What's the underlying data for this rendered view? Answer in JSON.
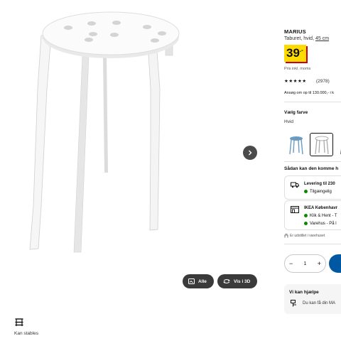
{
  "product": {
    "name": "MARIUS",
    "subtitle_prefix": "Taburet, hvid, ",
    "subtitle_size": "45 cm",
    "price_integer": "39",
    "price_decimal": ".-",
    "vat_note": "Pris inkl. moms",
    "rating_stars": "★★★★★",
    "rating": 4.5,
    "review_count": "(2978)",
    "finance_note": "Ansøg om op til 130.000,- i k"
  },
  "color": {
    "heading": "Vælg farve",
    "selected": "Hvid",
    "swatches": [
      {
        "name": "blue",
        "hex": "#6a9bc3"
      },
      {
        "name": "white",
        "hex": "#ffffff"
      },
      {
        "name": "black",
        "hex": "#222222"
      }
    ]
  },
  "delivery": {
    "heading": "Sådan kan den komme h",
    "shipping_title": "Levering til 230",
    "shipping_status": "Tilgængelig",
    "store_title": "IKEA Københavr",
    "store_pickup": "Klik & Hent - T",
    "store_warehouse": "Varehus - På l",
    "exhibit_note": "Er udstillet i varehuset"
  },
  "cart": {
    "quantity": "1",
    "minus": "−",
    "plus": "+"
  },
  "help": {
    "title": "Vi kan hjælpe",
    "text": "Du kan få din MA"
  },
  "gallery": {
    "all_label": "Alle",
    "view3d_label": "Vis i 3D",
    "stackable_label": "Kan stables"
  }
}
